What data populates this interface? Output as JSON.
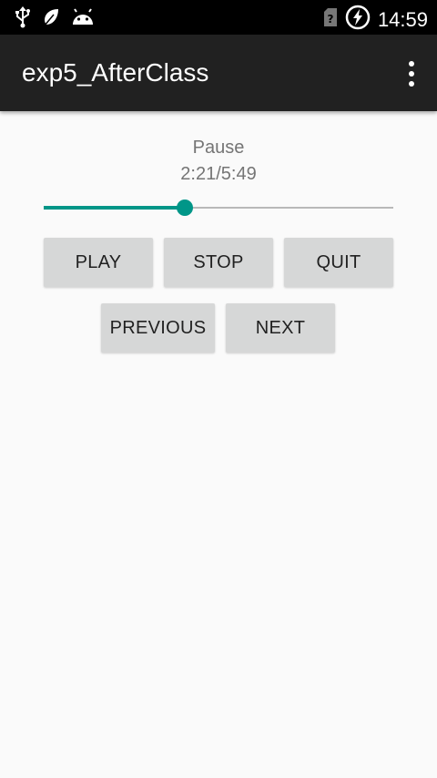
{
  "status_bar": {
    "time": "14:59",
    "icons": [
      "usb-icon",
      "leaf-icon",
      "android-icon",
      "no-sim-icon",
      "battery-charging-icon"
    ]
  },
  "app_bar": {
    "title": "exp5_AfterClass",
    "menu_icon": "overflow-menu-icon"
  },
  "player": {
    "state": "Pause",
    "time": "2:21/5:49",
    "progress_fraction": 0.404,
    "accent_color": "#009688"
  },
  "buttons": {
    "play": "PLAY",
    "stop": "STOP",
    "quit": "QUIT",
    "previous": "PREVIOUS",
    "next": "NEXT"
  }
}
